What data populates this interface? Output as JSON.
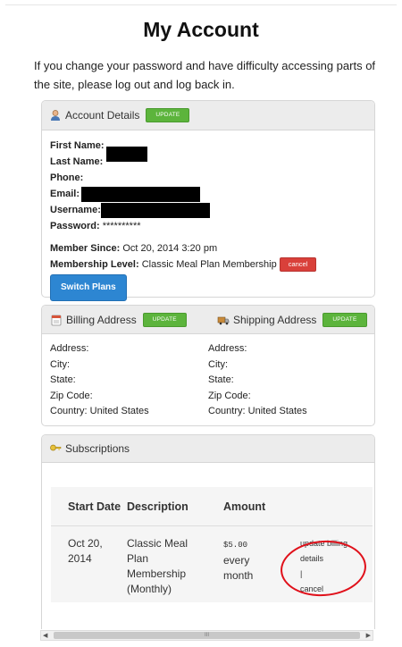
{
  "page": {
    "title": "My Account",
    "intro": "If you change your password and have difficulty accessing parts of the site, please log out and log back in."
  },
  "account": {
    "header": "Account Details",
    "update_label": "UPDATE",
    "first_name_label": "First Name:",
    "last_name_label": "Last Name:",
    "phone_label": "Phone:",
    "email_label": "Email:",
    "username_label": "Username:",
    "password_label": "Password:",
    "password_value": "**********",
    "member_since_label": "Member Since:",
    "member_since_value": "Oct 20, 2014 3:20 pm",
    "membership_level_label": "Membership Level:",
    "membership_level_value": "Classic Meal Plan Membership",
    "cancel_label": "cancel",
    "switch_plans_label": "Switch Plans"
  },
  "billing": {
    "header": "Billing Address",
    "update_label": "UPDATE",
    "address_label": "Address:",
    "city_label": "City:",
    "state_label": "State:",
    "zip_label": "Zip Code:",
    "country_label": "Country: United States"
  },
  "shipping": {
    "header": "Shipping Address",
    "update_label": "UPDATE",
    "address_label": "Address:",
    "city_label": "City:",
    "state_label": "State:",
    "zip_label": "Zip Code:",
    "country_label": "Country: United States"
  },
  "subscriptions": {
    "header": "Subscriptions",
    "columns": [
      "Start Date",
      "Description",
      "Amount",
      ""
    ],
    "row": {
      "date": "Oct 20, 2014",
      "description": "Classic Meal Plan Membership (Monthly)",
      "amount_value": "$5.00",
      "amount_period": "every month",
      "action_update": "update billing details",
      "action_sep": "|",
      "action_cancel": "cancel"
    }
  },
  "scrollbar": {
    "grip": "III"
  },
  "colors": {
    "update": "#5cb43c",
    "cancel": "#d9403a",
    "switch": "#2d86d2",
    "annotation_circle": "#e0101a"
  }
}
